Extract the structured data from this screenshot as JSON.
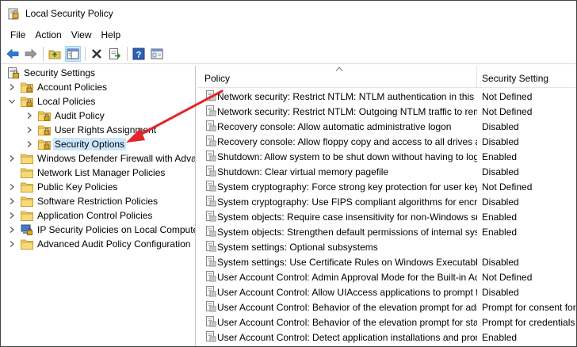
{
  "window": {
    "title": "Local Security Policy"
  },
  "menu": [
    "File",
    "Action",
    "View",
    "Help"
  ],
  "toolbar": {
    "buttons": [
      {
        "icon": "back-arrow-icon"
      },
      {
        "icon": "forward-arrow-icon"
      },
      {
        "icon": "up-folder-icon"
      },
      {
        "icon": "show-hide-tree-icon"
      },
      {
        "icon": "delete-icon"
      },
      {
        "icon": "export-list-icon"
      },
      {
        "icon": "help-icon"
      },
      {
        "icon": "properties-icon"
      }
    ]
  },
  "tree": {
    "items": [
      {
        "label": "Security Settings",
        "level": 0,
        "chevron": "",
        "icon": "security-settings"
      },
      {
        "label": "Account Policies",
        "level": 1,
        "chevron": "right",
        "icon": "folder-lock"
      },
      {
        "label": "Local Policies",
        "level": 1,
        "chevron": "down",
        "icon": "folder-lock"
      },
      {
        "label": "Audit Policy",
        "level": 2,
        "chevron": "right",
        "icon": "folder-lock"
      },
      {
        "label": "User Rights Assignment",
        "level": 2,
        "chevron": "right",
        "icon": "folder-lock"
      },
      {
        "label": "Security Options",
        "level": 2,
        "chevron": "right",
        "icon": "folder-lock",
        "selected": true
      },
      {
        "label": "Windows Defender Firewall with Advanced Security",
        "level": 1,
        "chevron": "right",
        "icon": "folder"
      },
      {
        "label": "Network List Manager Policies",
        "level": 1,
        "chevron": "",
        "icon": "folder"
      },
      {
        "label": "Public Key Policies",
        "level": 1,
        "chevron": "right",
        "icon": "folder"
      },
      {
        "label": "Software Restriction Policies",
        "level": 1,
        "chevron": "right",
        "icon": "folder"
      },
      {
        "label": "Application Control Policies",
        "level": 1,
        "chevron": "right",
        "icon": "folder"
      },
      {
        "label": "IP Security Policies on Local Computer",
        "level": 1,
        "chevron": "right",
        "icon": "ip-security"
      },
      {
        "label": "Advanced Audit Policy Configuration",
        "level": 1,
        "chevron": "right",
        "icon": "folder"
      }
    ]
  },
  "list": {
    "columns": {
      "policy": "Policy",
      "setting": "Security Setting"
    },
    "rows": [
      {
        "policy": "Network security: Restrict NTLM: NTLM authentication in this domain",
        "setting": "Not Defined"
      },
      {
        "policy": "Network security: Restrict NTLM: Outgoing NTLM traffic to remote servers",
        "setting": "Not Defined"
      },
      {
        "policy": "Recovery console: Allow automatic administrative logon",
        "setting": "Disabled"
      },
      {
        "policy": "Recovery console: Allow floppy copy and access to all drives and folders",
        "setting": "Disabled"
      },
      {
        "policy": "Shutdown: Allow system to be shut down without having to log on",
        "setting": "Enabled"
      },
      {
        "policy": "Shutdown: Clear virtual memory pagefile",
        "setting": "Disabled"
      },
      {
        "policy": "System cryptography: Force strong key protection for user keys stored on the computer",
        "setting": "Not Defined"
      },
      {
        "policy": "System cryptography: Use FIPS compliant algorithms for encryption, hashing, and signing",
        "setting": "Disabled"
      },
      {
        "policy": "System objects: Require case insensitivity for non-Windows subsystems",
        "setting": "Enabled"
      },
      {
        "policy": "System objects: Strengthen default permissions of internal system objects",
        "setting": "Enabled"
      },
      {
        "policy": "System settings: Optional subsystems",
        "setting": ""
      },
      {
        "policy": "System settings: Use Certificate Rules on Windows Executables for Software Restriction Policies",
        "setting": "Disabled"
      },
      {
        "policy": "User Account Control: Admin Approval Mode for the Built-in Administrator account",
        "setting": "Not Defined"
      },
      {
        "policy": "User Account Control: Allow UIAccess applications to prompt for elevation without using the secure desktop",
        "setting": "Disabled"
      },
      {
        "policy": "User Account Control: Behavior of the elevation prompt for administrators in Admin Approval Mode",
        "setting": "Prompt for consent for non-Windows binaries"
      },
      {
        "policy": "User Account Control: Behavior of the elevation prompt for standard users",
        "setting": "Prompt for credentials"
      },
      {
        "policy": "User Account Control: Detect application installations and prompt for elevation",
        "setting": "Enabled"
      }
    ]
  },
  "annotation": {
    "color": "#e0262b"
  }
}
